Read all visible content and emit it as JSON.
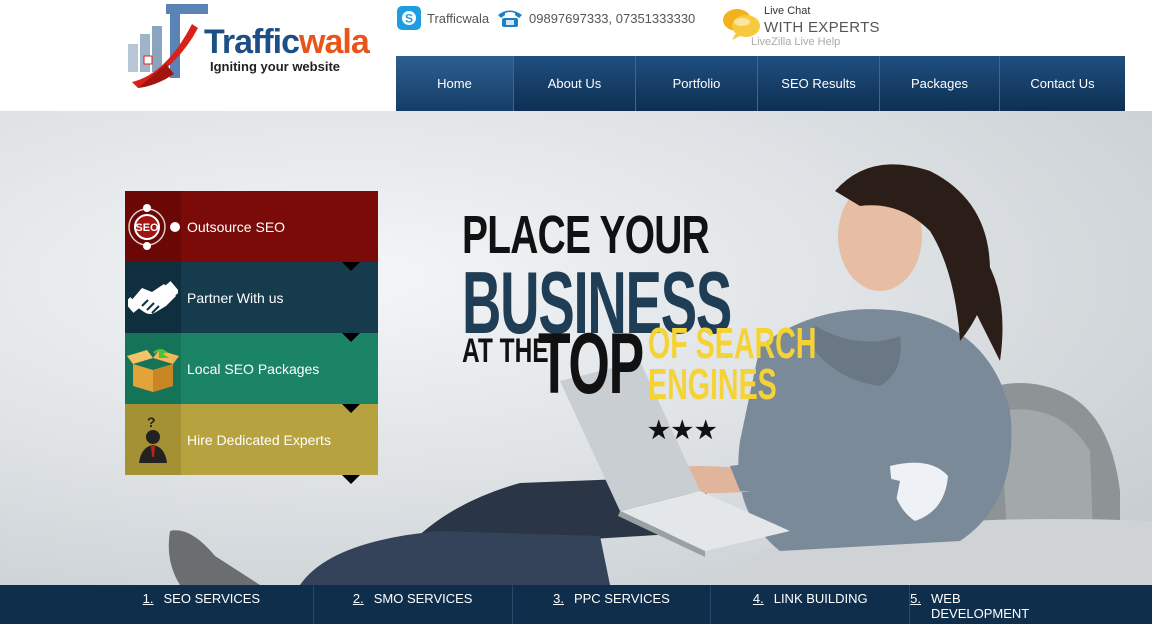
{
  "header": {
    "logo": {
      "brand_main": "Traffic",
      "brand_accent": "wala",
      "tagline": "Igniting your website"
    },
    "skype": {
      "label": "Trafficwala",
      "icon": "skype-icon"
    },
    "phone": {
      "label": "09897697333, 07351333330",
      "icon": "telephone-icon"
    },
    "livechat": {
      "line1": "Live Chat",
      "line2": "WITH EXPERTS",
      "line3": "LiveZilla Live Help",
      "icon": "chat-bubbles-icon"
    }
  },
  "nav": {
    "items": [
      {
        "label": "Home",
        "active": true
      },
      {
        "label": "About Us"
      },
      {
        "label": "Portfolio"
      },
      {
        "label": "SEO Results"
      },
      {
        "label": "Packages"
      },
      {
        "label": "Contact Us"
      }
    ]
  },
  "hero": {
    "headline": {
      "line1": "PLACE YOUR",
      "line2": "BUSINESS",
      "line3": "AT THE",
      "line4": "TOP",
      "line5": "OF SEARCH",
      "line6": "ENGINES",
      "stars": "★★★"
    },
    "side_menu": [
      {
        "label": "Outsource SEO",
        "icon": "seo-target-icon",
        "color": "#7b0b08"
      },
      {
        "label": "Partner With us",
        "icon": "handshake-icon",
        "color": "#163b4d"
      },
      {
        "label": "Local SEO Packages",
        "icon": "open-box-icon",
        "color": "#1b8366"
      },
      {
        "label": "Hire Dedicated Experts",
        "icon": "expert-person-icon",
        "color": "#b6a23f"
      }
    ]
  },
  "services": [
    {
      "num": "1.",
      "label": "SEO SERVICES"
    },
    {
      "num": "2.",
      "label": "SMO SERVICES"
    },
    {
      "num": "3.",
      "label": "PPC SERVICES"
    },
    {
      "num": "4.",
      "label": "LINK BUILDING"
    },
    {
      "num": "5.",
      "label": "WEB DEVELOPMENT"
    }
  ],
  "colors": {
    "nav_blue": "#0e2f52",
    "brand_orange": "#e8551c",
    "brand_blue": "#1c4f86",
    "headline_yellow": "#f6d335"
  }
}
